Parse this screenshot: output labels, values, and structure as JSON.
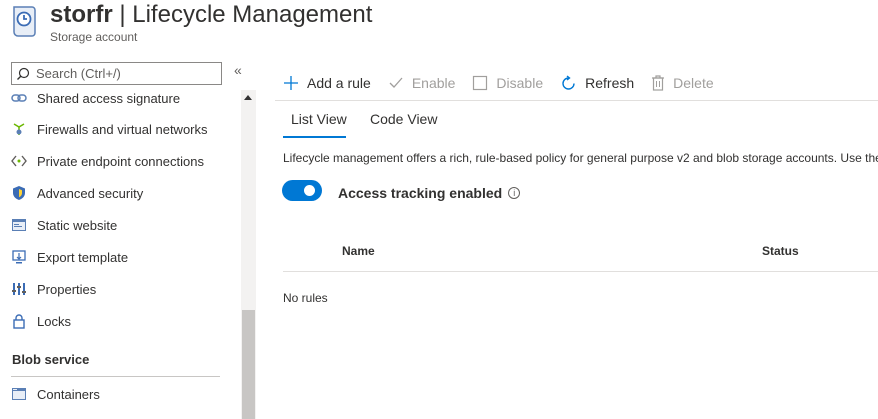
{
  "header": {
    "resource_name": "storfr",
    "separator": " | ",
    "page_title": "Lifecycle Management",
    "subtitle": "Storage account"
  },
  "sidebar": {
    "search_placeholder": "Search (Ctrl+/)",
    "collapse_glyph": "«",
    "items": [
      {
        "label": "Shared access signature",
        "icon": "link-icon"
      },
      {
        "label": "Firewalls and virtual networks",
        "icon": "firewall-icon"
      },
      {
        "label": "Private endpoint connections",
        "icon": "endpoint-icon"
      },
      {
        "label": "Advanced security",
        "icon": "shield-icon"
      },
      {
        "label": "Static website",
        "icon": "website-icon"
      },
      {
        "label": "Export template",
        "icon": "export-icon"
      },
      {
        "label": "Properties",
        "icon": "properties-icon"
      },
      {
        "label": "Locks",
        "icon": "lock-icon"
      }
    ],
    "group_label": "Blob service",
    "group_items": [
      {
        "label": "Containers",
        "icon": "containers-icon"
      }
    ]
  },
  "toolbar": {
    "add_rule": "Add a rule",
    "enable": "Enable",
    "disable": "Disable",
    "refresh": "Refresh",
    "delete": "Delete"
  },
  "tabs": {
    "list_view": "List View",
    "code_view": "Code View"
  },
  "main": {
    "description": "Lifecycle management offers a rich, rule-based policy for general purpose v2 and blob storage accounts. Use the",
    "access_tracking_label": "Access tracking enabled",
    "access_tracking_on": true,
    "info_glyph": "i",
    "columns": {
      "name": "Name",
      "status": "Status"
    },
    "empty_text": "No rules"
  },
  "colors": {
    "accent": "#0078d4",
    "text": "#323130",
    "disabled": "#a19f9d"
  }
}
